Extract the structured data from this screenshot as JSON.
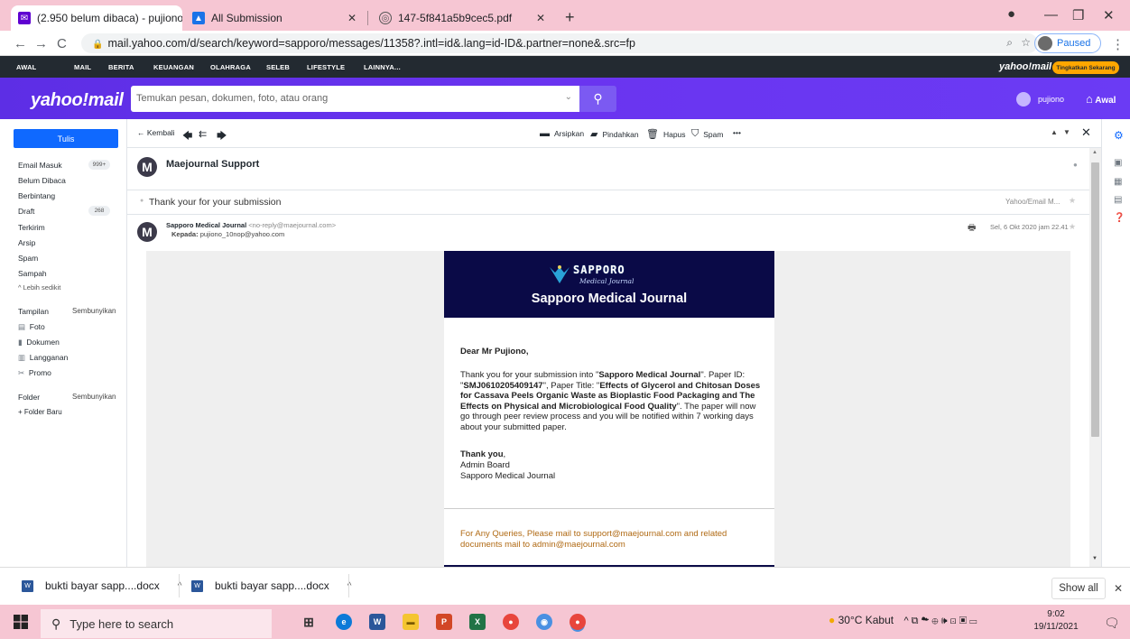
{
  "browser": {
    "tabs": [
      {
        "title": "(2.950 belum dibaca) - pujiono_1",
        "icon": "mail-icon",
        "active": true
      },
      {
        "title": "All Submission",
        "icon": "ojs-icon",
        "active": false
      },
      {
        "title": "147-5f841a5b9cec5.pdf",
        "icon": "globe-icon",
        "active": false
      }
    ],
    "url": "mail.yahoo.com/d/search/keyword=sapporo/messages/11358?.intl=id&.lang=id-ID&.partner=none&.src=fp",
    "profile_status": "Paused"
  },
  "ynav": {
    "items": [
      "AWAL",
      "MAIL",
      "BERITA",
      "KEUANGAN",
      "OLAHRAGA",
      "SELEB",
      "LIFESTYLE",
      "LAINNYA..."
    ],
    "brand": "yahoo!mail",
    "upgrade": "Tingkatkan Sekarang"
  },
  "header": {
    "logo": "yahoo!mail",
    "search_placeholder": "Temukan pesan, dokumen, foto, atau orang",
    "user": "pujiono",
    "home": "Awal"
  },
  "sidebar": {
    "compose": "Tulis",
    "folders": [
      {
        "label": "Email Masuk",
        "count": "999+"
      },
      {
        "label": "Belum Dibaca",
        "count": ""
      },
      {
        "label": "Berbintang",
        "count": ""
      },
      {
        "label": "Draft",
        "count": "268"
      },
      {
        "label": "Terkirim",
        "count": ""
      },
      {
        "label": "Arsip",
        "count": ""
      },
      {
        "label": "Spam",
        "count": ""
      },
      {
        "label": "Sampah",
        "count": ""
      }
    ],
    "less": "^ Lebih sedikit",
    "views_title": "Tampilan",
    "views_hide": "Sembunyikan",
    "views": [
      "Foto",
      "Dokumen",
      "Langganan",
      "Promo"
    ],
    "folder_title": "Folder",
    "folder_hide": "Sembunyikan",
    "new_folder": "+ Folder Baru"
  },
  "toolbar": {
    "back": "← Kembali",
    "archive": "Arsipkan",
    "move": "Pindahkan",
    "delete": "Hapus",
    "spam": "Spam",
    "more": "•••"
  },
  "message": {
    "sender_display": "Maejournal Support",
    "subject": "Thank your for your submission",
    "folder_tag": "Yahoo/Email M...",
    "from_name": "Sapporo Medical Journal",
    "from_email": "<no-reply@maejournal.com>",
    "to_label": "Kepada:",
    "to": "pujiono_10nop@yahoo.com",
    "date": "Sel, 6 Okt 2020 jam 22.41"
  },
  "email_body": {
    "logo_name": "SAPPORO",
    "logo_tagline": "Medical Journal",
    "banner_title": "Sapporo Medical Journal",
    "greeting": "Dear Mr Pujiono,",
    "p1_a": "Thank you for your submission into \"",
    "p1_journal": "Sapporo Medical Journal",
    "p1_b": "\". Paper ID: \"",
    "paper_id": "SMJ0610205409147",
    "p1_c": "\", Paper Title: \"",
    "paper_title": "Effects of Glycerol and Chitosan Doses for Cassava Peels Organic Waste as Bioplastic Food Packaging and The Effects on Physical and Microbiological Food Quality",
    "p1_d": "\". The paper will now go through peer review process and you will be notified within 7 working days about your submitted paper.",
    "thanks": "Thank you",
    "thanks_comma": ",",
    "sign1": "Admin Board",
    "sign2": "Sapporo Medical Journal",
    "footer": "For Any Queries, Please mail to support@maejournal.com and related documents mail to admin@maejournal.com"
  },
  "downloads": [
    {
      "name": "bukti bayar sapp....docx"
    },
    {
      "name": "bukti bayar sapp....docx"
    }
  ],
  "shelf": {
    "show_all": "Show all"
  },
  "taskbar": {
    "search": "Type here to search",
    "weather": "30°C  Kabut",
    "time": "9:02",
    "date": "19/11/2021"
  },
  "colors": {
    "yahoo_purple": "#6a34f0",
    "compose_blue": "#0f69ff",
    "journal_navy": "#0a0a47",
    "footer_orange": "#b06a14"
  }
}
